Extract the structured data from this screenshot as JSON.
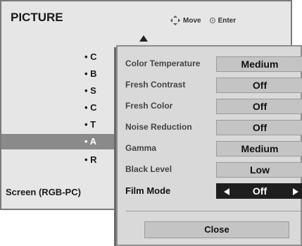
{
  "header": {
    "title": "PICTURE",
    "move_label": "Move",
    "enter_label": "Enter"
  },
  "menu": {
    "items": [
      {
        "label": "• C"
      },
      {
        "label": "• B"
      },
      {
        "label": "• S"
      },
      {
        "label": "• C"
      },
      {
        "label": "• T"
      },
      {
        "label": "• A"
      },
      {
        "label": "• R"
      }
    ],
    "selected_index": 5,
    "screen_label": "Screen (RGB-PC)"
  },
  "submenu": {
    "rows": [
      {
        "label": "Color Temperature",
        "value": "Medium"
      },
      {
        "label": "Fresh Contrast",
        "value": "Off"
      },
      {
        "label": "Fresh Color",
        "value": "Off"
      },
      {
        "label": "Noise Reduction",
        "value": "Off"
      },
      {
        "label": "Gamma",
        "value": "Medium"
      },
      {
        "label": "Black Level",
        "value": "Low"
      },
      {
        "label": "Film Mode",
        "value": "Off"
      }
    ],
    "active_index": 6,
    "close_label": "Close"
  }
}
